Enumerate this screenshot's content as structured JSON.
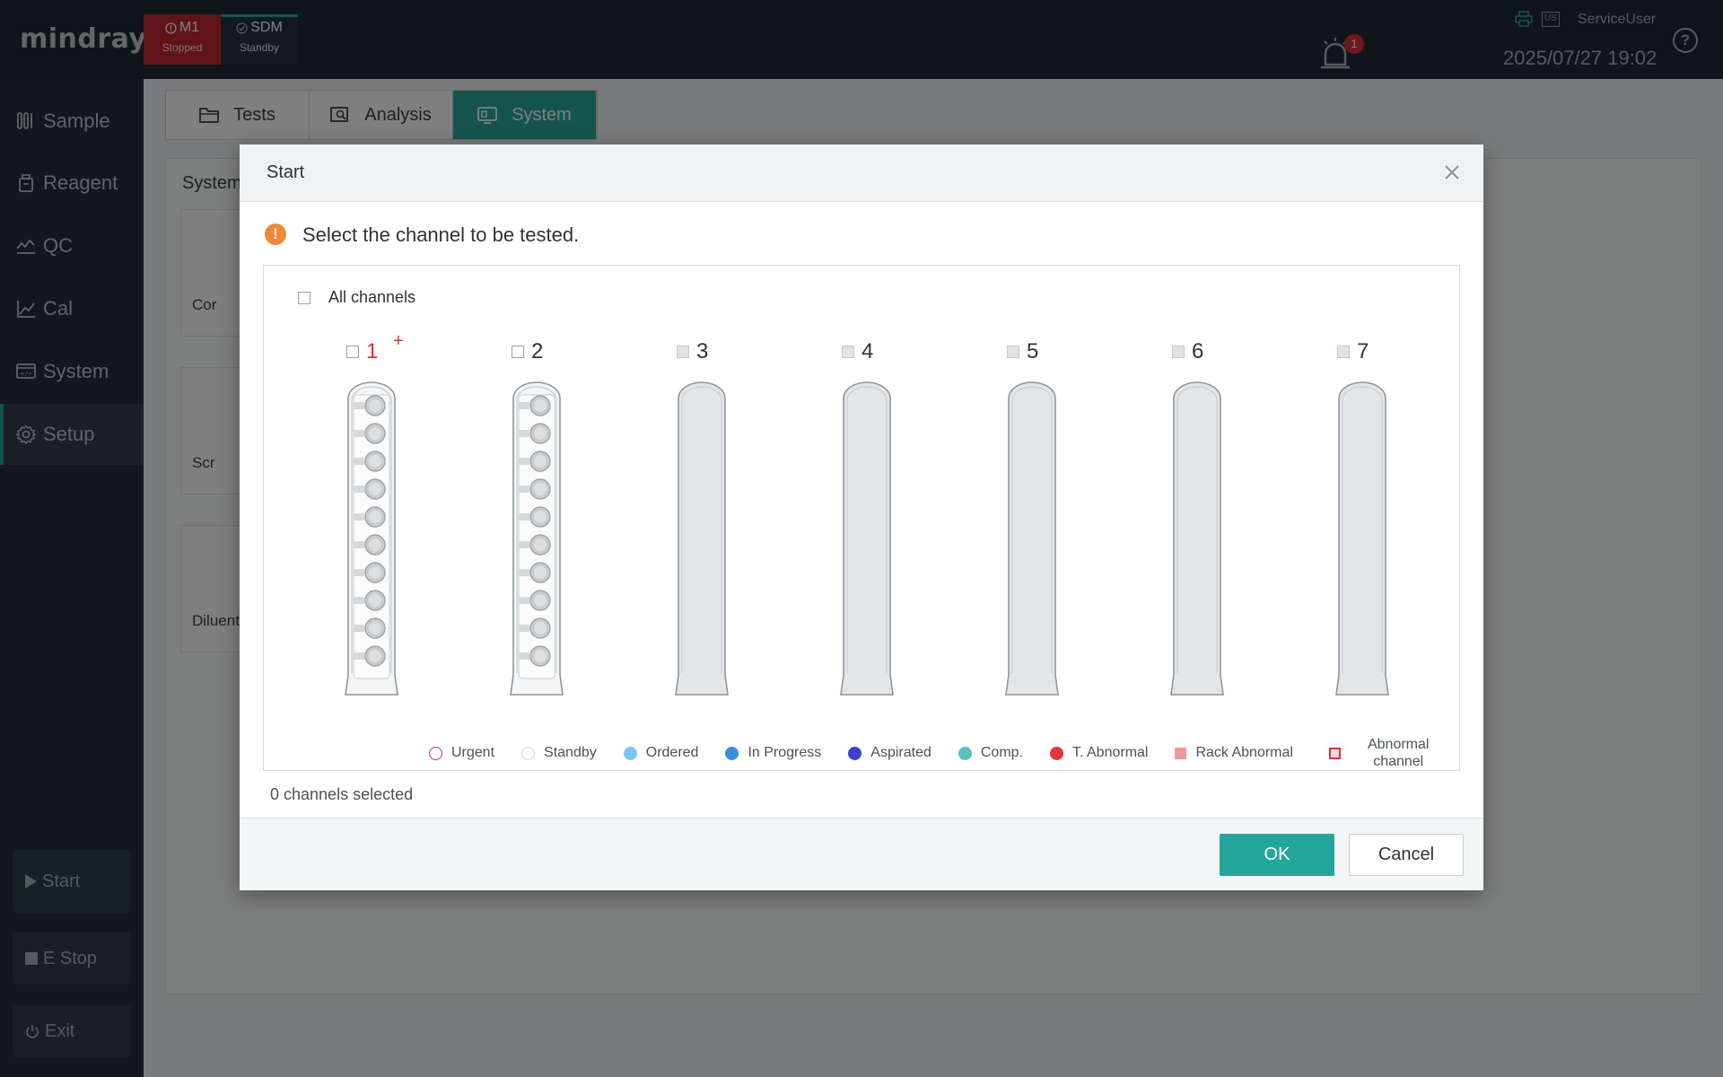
{
  "app": {
    "logo": "mindray"
  },
  "modules": [
    {
      "name": "M1",
      "state": "Stopped",
      "color": "#c0282e"
    },
    {
      "name": "SDM",
      "state": "Standby",
      "color": "#26343f"
    }
  ],
  "header": {
    "alarm_count": "1",
    "lang": "US",
    "username": "ServiceUser",
    "datetime": "2025/07/27 19:02",
    "help": "?"
  },
  "sidebar": {
    "items": [
      {
        "label": "Sample",
        "icon": "sample-tubes-icon"
      },
      {
        "label": "Reagent",
        "icon": "reagent-bottle-icon"
      },
      {
        "label": "QC",
        "icon": "qc-chart-icon"
      },
      {
        "label": "Cal",
        "icon": "cal-chart-icon"
      },
      {
        "label": "System",
        "icon": "system-monitor-icon"
      },
      {
        "label": "Setup",
        "icon": "gear-icon",
        "active": true
      }
    ],
    "start_label": "Start",
    "estop_label": "E Stop",
    "exit_label": "Exit"
  },
  "main": {
    "tabs": [
      {
        "label": "Tests",
        "icon": "folder-icon"
      },
      {
        "label": "Analysis",
        "icon": "analysis-search-icon"
      },
      {
        "label": "System",
        "icon": "system-monitor-icon",
        "active": true
      }
    ],
    "panel_title": "System",
    "cards": [
      "Cor",
      "Scr",
      "Diluent"
    ]
  },
  "dialog": {
    "title": "Start",
    "prompt": "Select the channel to be tested.",
    "all_channels_label": "All channels",
    "channels": [
      {
        "number": "1",
        "enabled": true,
        "abnormal": true,
        "urgent_marker": "+",
        "tubes": 10
      },
      {
        "number": "2",
        "enabled": true,
        "abnormal": false,
        "tubes": 10
      },
      {
        "number": "3",
        "enabled": false,
        "abnormal": false,
        "tubes": 0
      },
      {
        "number": "4",
        "enabled": false,
        "abnormal": false,
        "tubes": 0
      },
      {
        "number": "5",
        "enabled": false,
        "abnormal": false,
        "tubes": 0
      },
      {
        "number": "6",
        "enabled": false,
        "abnormal": false,
        "tubes": 0
      },
      {
        "number": "7",
        "enabled": false,
        "abnormal": false,
        "tubes": 0
      }
    ],
    "legend": [
      {
        "label": "Urgent",
        "shape": "ring",
        "color": "#d9323a"
      },
      {
        "label": "Standby",
        "shape": "ring",
        "color": "#d5d9dc"
      },
      {
        "label": "Ordered",
        "shape": "dot",
        "color": "#7cc4f2"
      },
      {
        "label": "In Progress",
        "shape": "dot",
        "color": "#3c8fe0"
      },
      {
        "label": "Aspirated",
        "shape": "dot",
        "color": "#3e3fd1"
      },
      {
        "label": "Comp.",
        "shape": "dot",
        "color": "#5bbfbf"
      },
      {
        "label": "T. Abnormal",
        "shape": "dot",
        "color": "#e2343d"
      },
      {
        "label": "Rack Abnormal",
        "shape": "square",
        "color": "#ef9a9a"
      },
      {
        "label": "Abnormal channel",
        "shape": "outline-square",
        "color": "#d9323a"
      }
    ],
    "legend_abnormal_line1": "Abnormal",
    "legend_abnormal_line2": "channel",
    "selected_count": "0 channels selected",
    "ok_label": "OK",
    "cancel_label": "Cancel"
  }
}
